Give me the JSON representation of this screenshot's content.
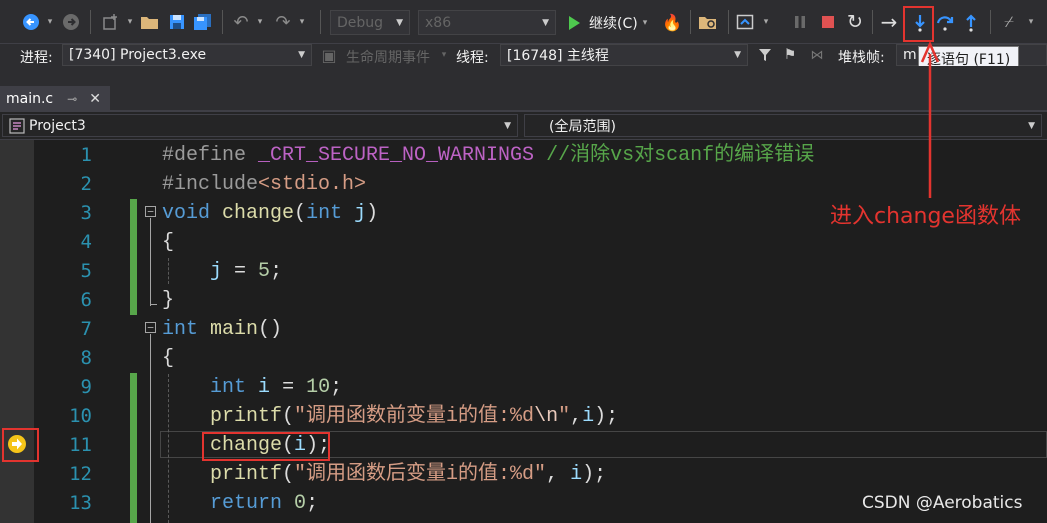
{
  "toolbar": {
    "config": "Debug",
    "platform": "x86",
    "continue_label": "继续(C)",
    "tooltip": "逐语句 (F11)"
  },
  "debugbar": {
    "process_label": "进程:",
    "process_value": "[7340] Project3.exe",
    "lifecycle_label": "生命周期事件",
    "thread_label": "线程:",
    "thread_value": "[16748] 主线程",
    "stackframe_label": "堆栈帧:",
    "stackframe_value": "m"
  },
  "tab": {
    "label": "main.c",
    "pin": "⊸",
    "close": "✕"
  },
  "nav": {
    "project": "Project3",
    "scope": "(全局范围)"
  },
  "code_lines": [
    {
      "n": "1",
      "parts": [
        [
          "pp",
          "#define "
        ],
        [
          "mac",
          "_CRT_SECURE_NO_WARNINGS"
        ],
        [
          "pl",
          " "
        ],
        [
          "cm",
          "//消除vs对scanf的编译错误"
        ]
      ]
    },
    {
      "n": "2",
      "parts": [
        [
          "pp",
          "#include"
        ],
        [
          "st",
          "<stdio.h>"
        ]
      ]
    },
    {
      "n": "3",
      "parts": [
        [
          "kw",
          "void"
        ],
        [
          "pl",
          " "
        ],
        [
          "fn",
          "change"
        ],
        [
          "pl",
          "("
        ],
        [
          "kw",
          "int"
        ],
        [
          "pl",
          " "
        ],
        [
          "vr",
          "j"
        ],
        [
          "pl",
          ")"
        ]
      ]
    },
    {
      "n": "4",
      "parts": [
        [
          "pl",
          "{"
        ]
      ]
    },
    {
      "n": "5",
      "parts": [
        [
          "pl",
          "    "
        ],
        [
          "vr",
          "j"
        ],
        [
          "pl",
          " = "
        ],
        [
          "nm",
          "5"
        ],
        [
          "pl",
          ";"
        ]
      ]
    },
    {
      "n": "6",
      "parts": [
        [
          "pl",
          "}"
        ]
      ]
    },
    {
      "n": "7",
      "parts": [
        [
          "kw",
          "int"
        ],
        [
          "pl",
          " "
        ],
        [
          "fn",
          "main"
        ],
        [
          "pl",
          "()"
        ]
      ]
    },
    {
      "n": "8",
      "parts": [
        [
          "pl",
          "{"
        ]
      ]
    },
    {
      "n": "9",
      "parts": [
        [
          "pl",
          "    "
        ],
        [
          "kw",
          "int"
        ],
        [
          "pl",
          " "
        ],
        [
          "vr",
          "i"
        ],
        [
          "pl",
          " = "
        ],
        [
          "nm",
          "10"
        ],
        [
          "pl",
          ";"
        ]
      ]
    },
    {
      "n": "10",
      "parts": [
        [
          "pl",
          "    "
        ],
        [
          "fn",
          "printf"
        ],
        [
          "pl",
          "("
        ],
        [
          "st",
          "\"调用函数前变量i的值:%d"
        ],
        [
          "es",
          "\\n"
        ],
        [
          "st",
          "\""
        ],
        [
          "pl",
          ","
        ],
        [
          "vr",
          "i"
        ],
        [
          "pl",
          ");"
        ]
      ]
    },
    {
      "n": "11",
      "parts": [
        [
          "pl",
          "    "
        ],
        [
          "fn",
          "change"
        ],
        [
          "pl",
          "("
        ],
        [
          "vr",
          "i"
        ],
        [
          "pl",
          ");"
        ]
      ]
    },
    {
      "n": "12",
      "parts": [
        [
          "pl",
          "    "
        ],
        [
          "fn",
          "printf"
        ],
        [
          "pl",
          "("
        ],
        [
          "st",
          "\"调用函数后变量i的值:%d\""
        ],
        [
          "pl",
          ", "
        ],
        [
          "vr",
          "i"
        ],
        [
          "pl",
          ");"
        ]
      ]
    },
    {
      "n": "13",
      "parts": [
        [
          "pl",
          "    "
        ],
        [
          "kw",
          "return"
        ],
        [
          "pl",
          " "
        ],
        [
          "nm",
          "0"
        ],
        [
          "pl",
          ";"
        ]
      ]
    }
  ],
  "annotation": "进入change函数体",
  "watermark": "CSDN @Aerobatics",
  "colors": {
    "accent": "#e3342f",
    "continue": "#4ec94e",
    "stop": "#e05252",
    "step_into": "#3794ff"
  }
}
